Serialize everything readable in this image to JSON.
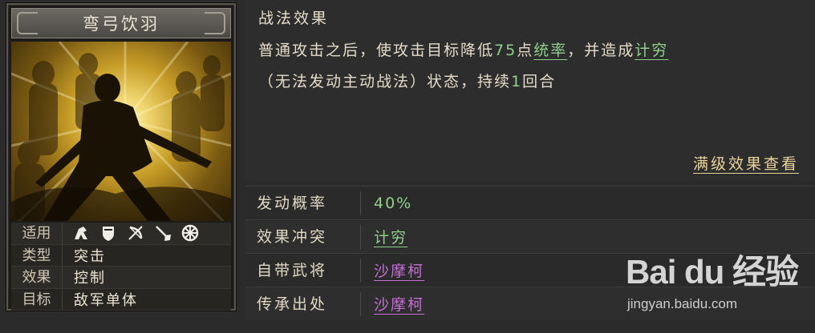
{
  "card": {
    "title": "弯弓饮羽",
    "attributes": {
      "apply_label": "适用",
      "apply_icons": [
        "cavalry-icon",
        "shield-icon",
        "bow-icon",
        "spear-icon",
        "chariot-wheel-icon"
      ],
      "type_label": "类型",
      "type_value": "突击",
      "effect_label": "效果",
      "effect_value": "控制",
      "target_label": "目标",
      "target_value": "敌军单体"
    }
  },
  "description": {
    "title": "战法效果",
    "line1_a": "普通攻击之后，使攻击目标降低",
    "line1_num": "75",
    "line1_b": "点",
    "line1_stat": "统率",
    "line1_c": "，并造成",
    "line1_status": "计穷",
    "line2_a": "（无法发动主动战法）状态，持续",
    "line2_num": "1",
    "line2_b": "回合",
    "more_link": "满级效果查看"
  },
  "info": {
    "rows": [
      {
        "label": "发动概率",
        "value": "40%"
      },
      {
        "label": "效果冲突",
        "value": "计穷"
      },
      {
        "label": "自带武将",
        "value": "沙摩柯"
      },
      {
        "label": "传承出处",
        "value": "沙摩柯"
      }
    ]
  },
  "watermark": {
    "logo": "Bai du 经验",
    "sub": "jingyan.baidu.com"
  },
  "colors": {
    "green": "#8fd08a",
    "purple": "#c56fd6",
    "gold": "#e9d39a"
  }
}
